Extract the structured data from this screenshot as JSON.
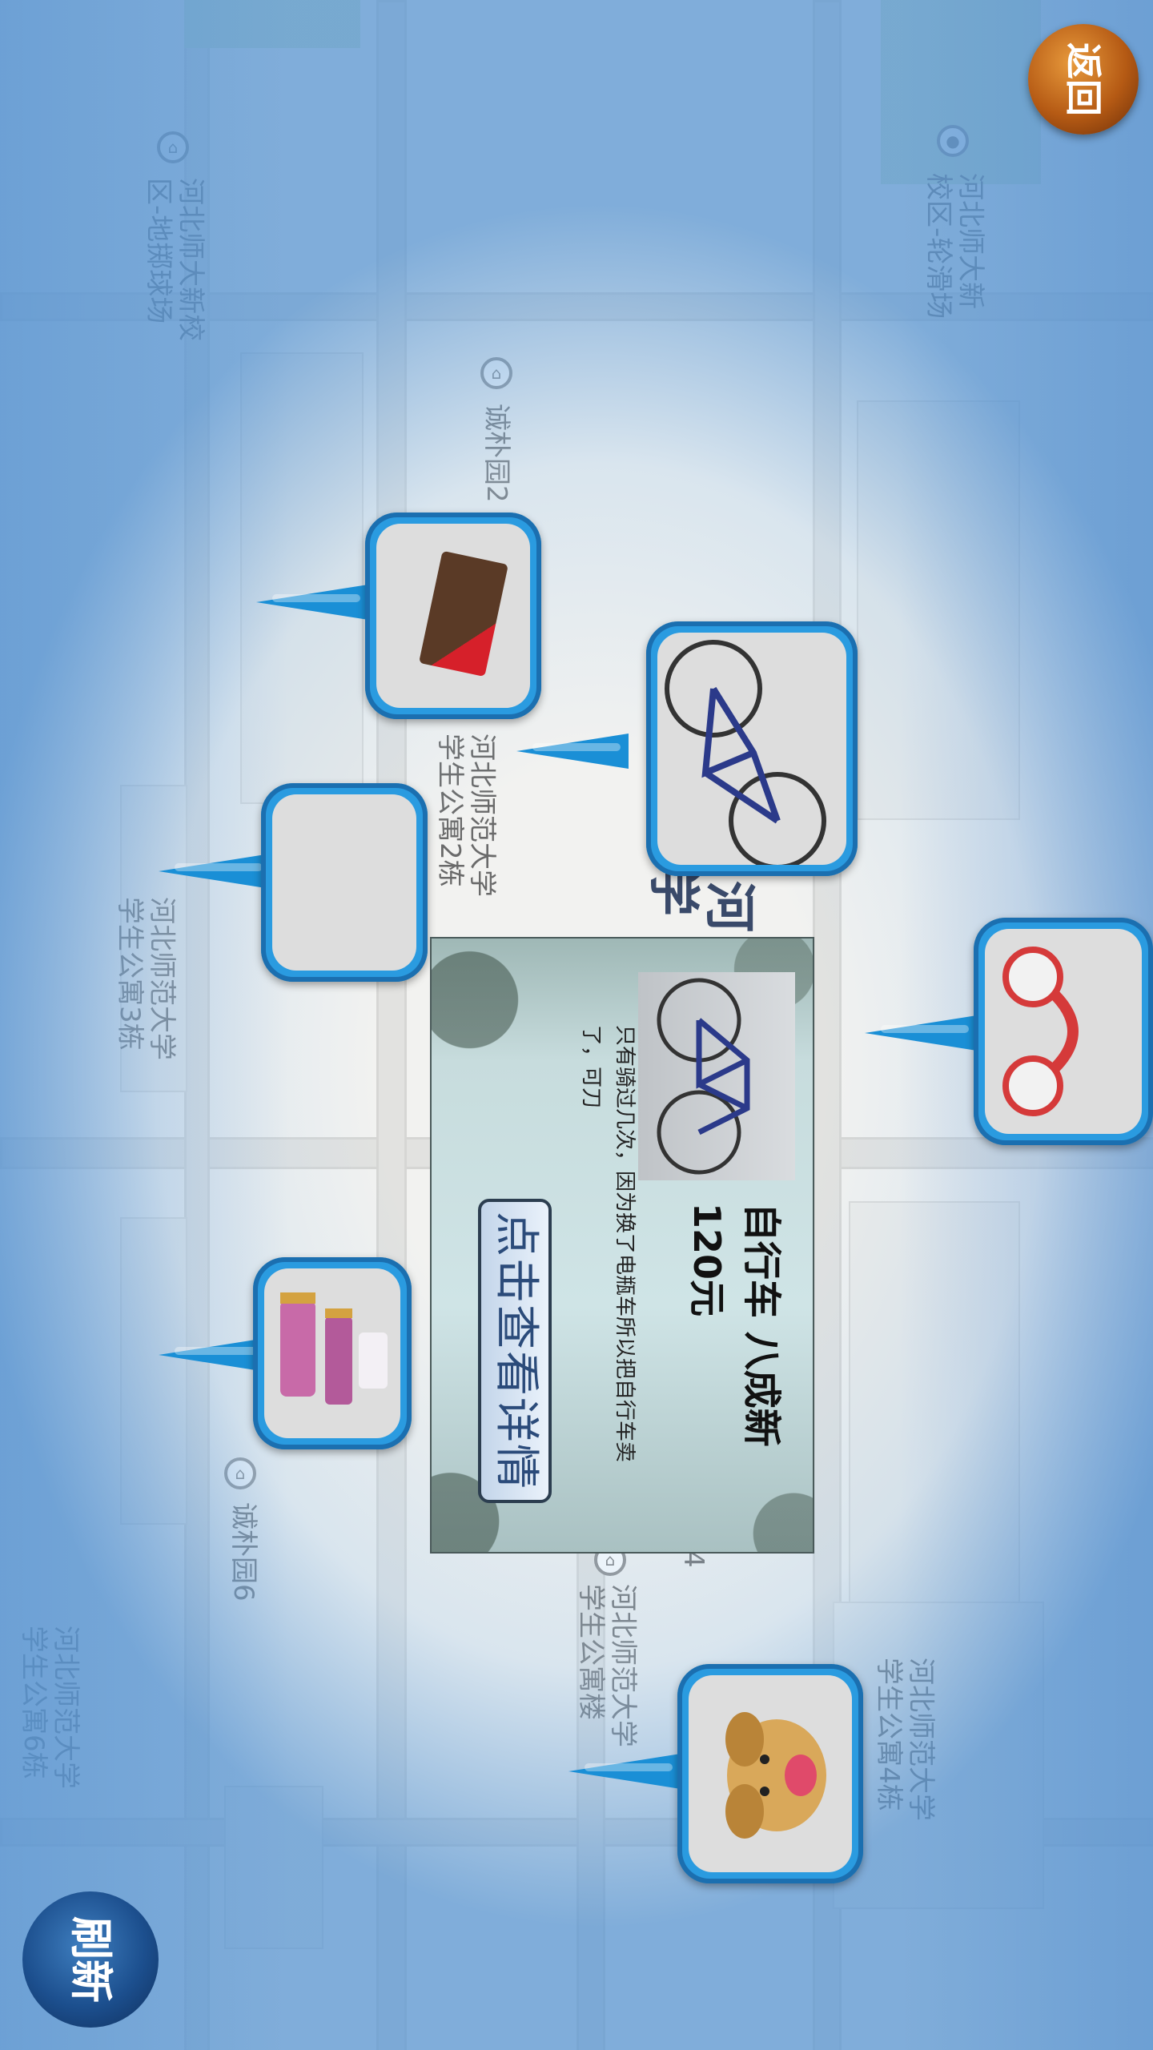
{
  "map": {
    "labels": [
      {
        "lines": [
          "河北师大新",
          "校区-轮滑场"
        ]
      },
      {
        "lines": [
          "河北师大新校",
          "区-地掷球场"
        ]
      },
      {
        "lines": [
          "诚朴园2"
        ]
      },
      {
        "lines": [
          "河北师范大学",
          "学生公寓2栋"
        ]
      },
      {
        "lines": [
          "河北师范大学",
          "学生公寓3栋"
        ]
      },
      {
        "lines": [
          "诚朴园6"
        ]
      },
      {
        "lines": [
          "河北师范大学",
          "学生公寓楼"
        ]
      },
      {
        "lines": [
          "河北师范大学",
          "学生公寓4栋"
        ]
      },
      {
        "lines": [
          "河北师范大学",
          "学生公寓6栋"
        ]
      },
      {
        "lines": [
          "河"
        ]
      },
      {
        "lines": [
          "学"
        ]
      },
      {
        "lines": [
          "4"
        ]
      }
    ]
  },
  "markers": [
    {
      "item": "bag",
      "icon": "bag-photo"
    },
    {
      "item": "bicycle",
      "icon": "bicycle-photo"
    },
    {
      "item": "wallet",
      "icon": "wallet-photo"
    },
    {
      "item": "headphones",
      "icon": "headphones-photo"
    },
    {
      "item": "cosmetics",
      "icon": "cosmetics-photo"
    },
    {
      "item": "dog",
      "icon": "dog-photo"
    }
  ],
  "popup": {
    "title": "自行车 八成新",
    "price": "120元",
    "description": "只有骑过几次，因为换了电瓶车所以把自行车卖了，可刀",
    "detail_button": "点击查看详情"
  },
  "buttons": {
    "back": "返回",
    "refresh": "刷新"
  },
  "colors": {
    "marker_blue": "#1a8fd6",
    "back_button": "#b55a14",
    "refresh_button": "#1c4f8e"
  }
}
